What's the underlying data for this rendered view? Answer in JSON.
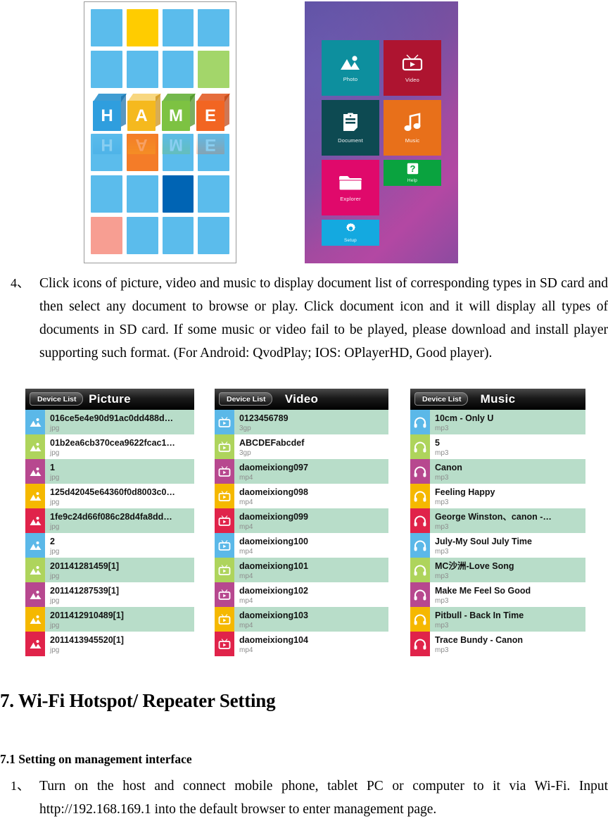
{
  "figures": {
    "hame_logo": {
      "alt_name": "HAME logo tile mosaic",
      "letters": [
        {
          "char": "H",
          "color": "#2f9ede",
          "top_color": "#1f8ccb",
          "side_color": "#1b6fa8"
        },
        {
          "char": "A",
          "color": "#f5b91e",
          "top_color": "#f7d06a",
          "side_color": "#c98d12"
        },
        {
          "char": "M",
          "color": "#7dc242",
          "top_color": "#5cab2e",
          "side_color": "#4a8f24"
        },
        {
          "char": "E",
          "color": "#f26522",
          "top_color": "#e2531a",
          "side_color": "#bd4312"
        }
      ],
      "grid_rows": [
        [
          "#5bbcec",
          "#ffcc00",
          "#5bbcec",
          "#5bbcec"
        ],
        [
          "#5bbcec",
          "#5bbcec",
          "#5bbcec",
          "#a3d66a"
        ],
        [
          "#5bbcec",
          "#f47c28",
          "#5bbcec",
          "#5bbcec"
        ],
        [
          "#5bbcec",
          "#5bbcec",
          "#0064b4",
          "#5bbcec"
        ],
        [
          "#f79e92",
          "#5bbcec",
          "#5bbcec",
          "#5bbcec"
        ]
      ]
    },
    "tile_menu": {
      "alt_name": "Device main menu tiles",
      "tiles": [
        {
          "label": "Photo",
          "icon": "photo-icon",
          "color": "#0d8f9e",
          "size": "full"
        },
        {
          "label": "Video",
          "icon": "tv-play-icon",
          "color": "#ae1430",
          "size": "full"
        },
        {
          "label": "Document",
          "icon": "document-icon",
          "color": "#0d4a52",
          "size": "full"
        },
        {
          "label": "Music",
          "icon": "music-icon",
          "color": "#e8701a",
          "size": "full"
        },
        {
          "label": "Explorer",
          "icon": "folder-icon",
          "color": "#e0096b",
          "size": "tall"
        },
        {
          "label": "Help",
          "icon": "question-icon",
          "color": "#0aa33f",
          "size": "half"
        },
        {
          "label": "Setup",
          "icon": "gear-icon",
          "color": "#14a9e0",
          "size": "half"
        }
      ]
    }
  },
  "paragraph_4": {
    "number": "4、",
    "text": "Click icons of picture, video and music to display document list of corresponding types in SD card and then select any document to browse or play. Click document icon and it will display all types of documents in SD card. If some music or video fail to be played, please download and install player supporting such format. (For Android: QvodPlay; IOS: OPlayerHD, Good player)."
  },
  "shots": {
    "back_label": "Device List",
    "row_colors": [
      "#5bb8e8",
      "#aed45c",
      "#b7488f",
      "#f5b800",
      "#e0234a"
    ],
    "alt_row_bg": "#b8ddc9",
    "picture": {
      "title": "Picture",
      "icon": "image-icon",
      "rows": [
        {
          "name": "016ce5e4e90d91ac0dd488d…",
          "ext": "jpg"
        },
        {
          "name": "01b2ea6cb370cea9622fcac1…",
          "ext": "jpg"
        },
        {
          "name": "1",
          "ext": "jpg"
        },
        {
          "name": "125d42045e64360f0d8003c0…",
          "ext": "jpg"
        },
        {
          "name": "1fe9c24d66f086c28d4fa8dd…",
          "ext": "jpg"
        },
        {
          "name": "2",
          "ext": "jpg"
        },
        {
          "name": "201141281459[1]",
          "ext": "jpg"
        },
        {
          "name": "201141287539[1]",
          "ext": "jpg"
        },
        {
          "name": "2011412910489[1]",
          "ext": "jpg"
        },
        {
          "name": "2011413945520[1]",
          "ext": "jpg"
        }
      ]
    },
    "video": {
      "title": "Video",
      "icon": "tv-play-icon",
      "rows": [
        {
          "name": "0123456789",
          "ext": "3gp"
        },
        {
          "name": "ABCDEFabcdef",
          "ext": "3gp"
        },
        {
          "name": "daomeixiong097",
          "ext": "mp4"
        },
        {
          "name": "daomeixiong098",
          "ext": "mp4"
        },
        {
          "name": "daomeixiong099",
          "ext": "mp4"
        },
        {
          "name": "daomeixiong100",
          "ext": "mp4"
        },
        {
          "name": "daomeixiong101",
          "ext": "mp4"
        },
        {
          "name": "daomeixiong102",
          "ext": "mp4"
        },
        {
          "name": "daomeixiong103",
          "ext": "mp4"
        },
        {
          "name": "daomeixiong104",
          "ext": "mp4"
        }
      ]
    },
    "music": {
      "title": "Music",
      "icon": "headphones-icon",
      "rows": [
        {
          "name": "10cm - Only U",
          "ext": "mp3"
        },
        {
          "name": "5",
          "ext": "mp3"
        },
        {
          "name": "Canon",
          "ext": "mp3"
        },
        {
          "name": "Feeling Happy",
          "ext": "mp3"
        },
        {
          "name": "George Winston、canon -…",
          "ext": "mp3"
        },
        {
          "name": "July-My Soul July Time",
          "ext": "mp3"
        },
        {
          "name": "MC沙洲-Love Song",
          "ext": "mp3"
        },
        {
          "name": "Make Me Feel So Good",
          "ext": "mp3"
        },
        {
          "name": "Pitbull - Back In Time",
          "ext": "mp3"
        },
        {
          "name": "Trace Bundy - Canon",
          "ext": "mp3"
        }
      ]
    }
  },
  "section_7": {
    "heading": "7. Wi-Fi Hotspot/ Repeater Setting",
    "subheading": "7.1 Setting on management interface",
    "paragraph_1": {
      "number": "1、",
      "text": "Turn on the host and connect mobile phone, tablet PC or computer to it via Wi-Fi. Input http://192.168.169.1 into the default browser to enter management page."
    }
  }
}
